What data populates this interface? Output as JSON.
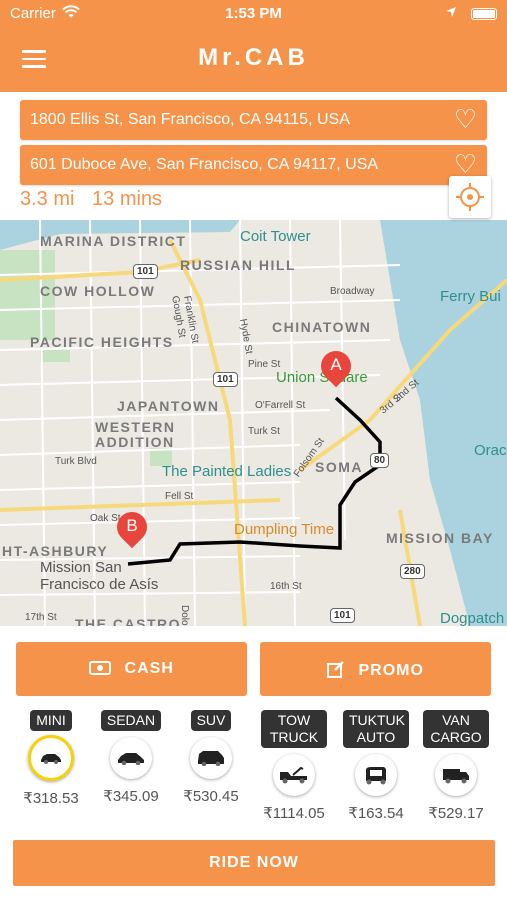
{
  "status": {
    "carrier": "Carrier",
    "time": "1:53 PM"
  },
  "app": {
    "title": "Mr.CAB"
  },
  "route": {
    "from": "1800 Ellis St, San Francisco, CA 94115, USA",
    "to": "601 Duboce Ave, San Francisco, CA 94117, USA",
    "distance": "3.3 mi",
    "duration": "13 mins"
  },
  "map": {
    "areas": [
      "MARINA DISTRICT",
      "RUSSIAN HILL",
      "COW HOLLOW",
      "PACIFIC HEIGHTS",
      "CHINATOWN",
      "JAPANTOWN",
      "WESTERN ADDITION",
      "SOMA",
      "MISSION BAY",
      "HT-ASHBURY",
      "THE CASTRO"
    ],
    "pois": [
      "Coit Tower",
      "Ferry Bui",
      "Union Square",
      "The Painted Ladies",
      "Dumpling Time",
      "Mission San Francisco de Asís",
      "Orac",
      "Dogpatch"
    ],
    "roads": [
      "Broadway",
      "Franklin St",
      "Gough St",
      "Hyde St",
      "Pine St",
      "O'Farrell St",
      "Turk St",
      "Turk Blvd",
      "Fell St",
      "Oak St",
      "Folsom St",
      "16th St",
      "17th St",
      "3rd St",
      "2nd St",
      "Dolo"
    ],
    "shields": [
      "101",
      "101",
      "80",
      "280",
      "101"
    ],
    "marker_a": "A",
    "marker_b": "B"
  },
  "actions": {
    "cash": "CASH",
    "promo": "PROMO"
  },
  "vehicles": [
    {
      "label": "MINI",
      "price": "₹318.53"
    },
    {
      "label": "SEDAN",
      "price": "₹345.09"
    },
    {
      "label": "SUV",
      "price": "₹530.45"
    },
    {
      "label": "TOW TRUCK",
      "price": "₹1114.05"
    },
    {
      "label": "TUKTUK AUTO",
      "price": "₹163.54"
    },
    {
      "label": "VAN CARGO",
      "price": "₹529.17"
    }
  ],
  "ride_now": "RIDE NOW",
  "colors": {
    "accent": "#f5934a",
    "selected_ring": "#f5d20a"
  }
}
